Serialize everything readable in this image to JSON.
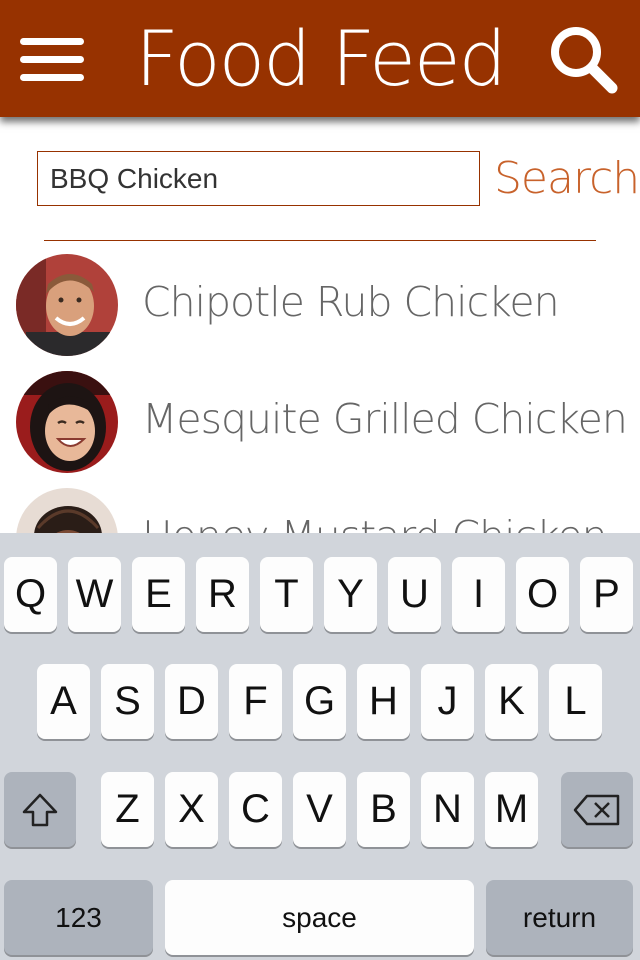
{
  "header": {
    "title": "Food Feed",
    "menu_icon": "hamburger-menu-icon",
    "search_icon": "magnifying-glass-icon",
    "bar_color": "#973200"
  },
  "search": {
    "value": "BBQ Chicken",
    "button_label": "Search"
  },
  "results": [
    {
      "label": "Chipotle Rub Chicken",
      "avatar": "avatar-man-smiling"
    },
    {
      "label": "Mesquite Grilled Chicken",
      "avatar": "avatar-woman-laughing"
    },
    {
      "label": "Honey Mustard Chicken",
      "avatar": "avatar-person-braids"
    }
  ],
  "keyboard": {
    "row1": [
      "Q",
      "W",
      "E",
      "R",
      "T",
      "Y",
      "U",
      "I",
      "O",
      "P"
    ],
    "row2": [
      "A",
      "S",
      "D",
      "F",
      "G",
      "H",
      "J",
      "K",
      "L"
    ],
    "row3": [
      "Z",
      "X",
      "C",
      "V",
      "B",
      "N",
      "M"
    ],
    "shift_icon": "shift-arrow-icon",
    "delete_icon": "backspace-icon",
    "numbers_label": "123",
    "space_label": "space",
    "return_label": "return"
  },
  "colors": {
    "accent": "#c8622b",
    "keyboard_bg": "#d1d5db",
    "key_bg": "#fdfdfd",
    "special_key_bg": "#adb3bc"
  }
}
